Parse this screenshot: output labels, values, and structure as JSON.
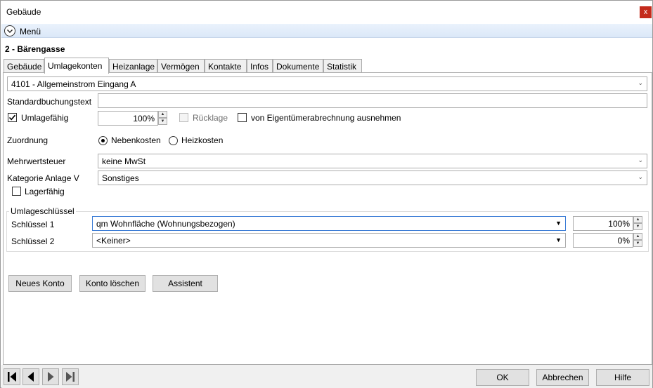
{
  "window": {
    "title": "Gebäude",
    "close_label": "x"
  },
  "menu": {
    "label": "Menü"
  },
  "record": {
    "title": "2 - Bärengasse"
  },
  "tabs": [
    {
      "label": "Gebäude"
    },
    {
      "label": "Umlagekonten"
    },
    {
      "label": "Heizanlage"
    },
    {
      "label": "Vermögen"
    },
    {
      "label": "Kontakte"
    },
    {
      "label": "Infos"
    },
    {
      "label": "Dokumente"
    },
    {
      "label": "Statistik"
    }
  ],
  "form": {
    "account_value": "4101 - Allgemeinstrom Eingang A",
    "standard_text_label": "Standardbuchungstext",
    "standard_text_value": "",
    "umlagefaehig_label": "Umlagefähig",
    "umlagefaehig_checked": true,
    "percent_value": "100%",
    "ruecklage_label": "Rücklage",
    "ausnehmen_label": "von Eigentümerabrechnung ausnehmen",
    "zuordnung_label": "Zuordnung",
    "nebenkosten_label": "Nebenkosten",
    "heizkosten_label": "Heizkosten",
    "selected_zuordnung": "Nebenkosten",
    "mwst_label": "Mehrwertsteuer",
    "mwst_value": "keine MwSt",
    "kategorie_label": "Kategorie Anlage V",
    "kategorie_value": "Sonstiges",
    "lagerfaehig_label": "Lagerfähig"
  },
  "umlageschluessel": {
    "title": "Umlageschlüssel",
    "rows": [
      {
        "label": "Schlüssel 1",
        "value": "qm Wohnfläche (Wohnungsbezogen)",
        "percent": "100%"
      },
      {
        "label": "Schlüssel 2",
        "value": "<Keiner>",
        "percent": "0%"
      }
    ]
  },
  "actions": {
    "new_account": "Neues Konto",
    "delete_account": "Konto löschen",
    "assistant": "Assistent"
  },
  "footer": {
    "ok": "OK",
    "cancel": "Abbrechen",
    "help": "Hilfe",
    "nav_icons": [
      "first-record-icon",
      "previous-record-icon",
      "next-record-icon",
      "last-record-icon"
    ]
  },
  "colors": {
    "close_button": "#c42b1c",
    "menu_bar": "#dbe8f8",
    "selected_field_border": "#3a7bd5"
  }
}
